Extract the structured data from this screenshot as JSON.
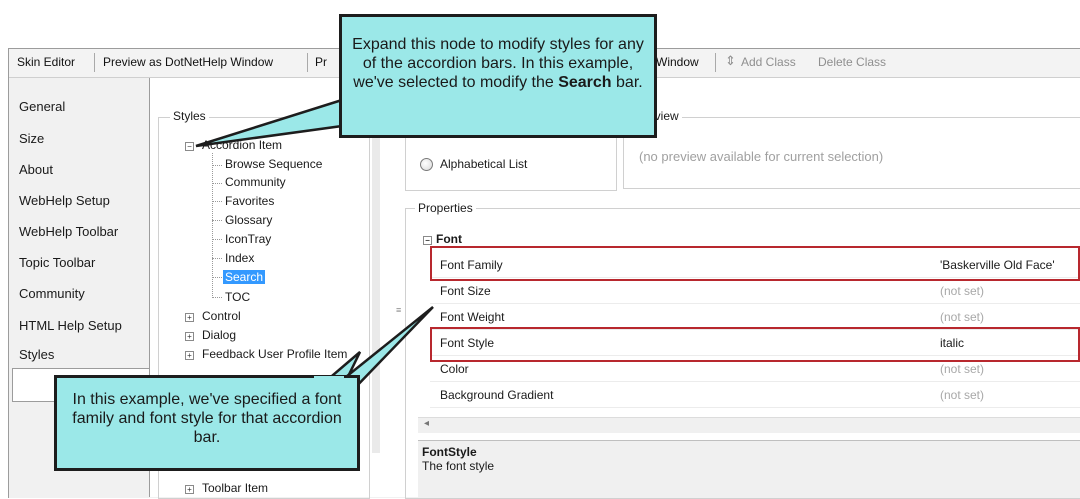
{
  "toolbar": {
    "items": [
      "Skin Editor",
      "Preview as DotNetHelp Window",
      "Pr",
      "p Window",
      "Add Class",
      "Delete Class"
    ]
  },
  "sidebar": {
    "items": [
      "General",
      "Size",
      "About",
      "WebHelp Setup",
      "WebHelp Toolbar",
      "Topic Toolbar",
      "Community",
      "HTML Help Setup",
      "Styles"
    ],
    "selected": "Styles"
  },
  "styles_group": {
    "label": "Styles",
    "tree": {
      "root": "Accordion Item",
      "children": [
        "Browse Sequence",
        "Community",
        "Favorites",
        "Glossary",
        "IconTray",
        "Index",
        "Search",
        "TOC"
      ],
      "selected": "Search",
      "siblings": [
        "Control",
        "Dialog",
        "Feedback User Profile Item"
      ],
      "bottom": "Toolbar Item"
    }
  },
  "preview_group": {
    "label": "eview",
    "radio_label": "Alphabetical List",
    "message": "(no preview available for current selection)"
  },
  "properties": {
    "label": "Properties",
    "category": "Font",
    "rows": [
      {
        "name": "Font Family",
        "value": "'Baskerville Old Face'",
        "set": true
      },
      {
        "name": "Font Size",
        "value": "(not set)",
        "set": false
      },
      {
        "name": "Font Weight",
        "value": "(not set)",
        "set": false
      },
      {
        "name": "Font Style",
        "value": "italic",
        "set": true
      },
      {
        "name": "Color",
        "value": "(not set)",
        "set": false
      },
      {
        "name": "Background Gradient",
        "value": "(not set)",
        "set": false
      }
    ]
  },
  "description": {
    "title": "FontStyle",
    "text": "The font style"
  },
  "callouts": {
    "top": {
      "before": "Expand this node to modify styles for any of the accordion bars. In this example, we've selected to modify the ",
      "bold": "Search",
      "after": " bar."
    },
    "bottom": "In this example, we've specified a font family and font style for that accordion bar."
  },
  "colors": {
    "callout": "#9be8e8",
    "highlight_box": "#b8282e",
    "selection": "#3399ff"
  }
}
